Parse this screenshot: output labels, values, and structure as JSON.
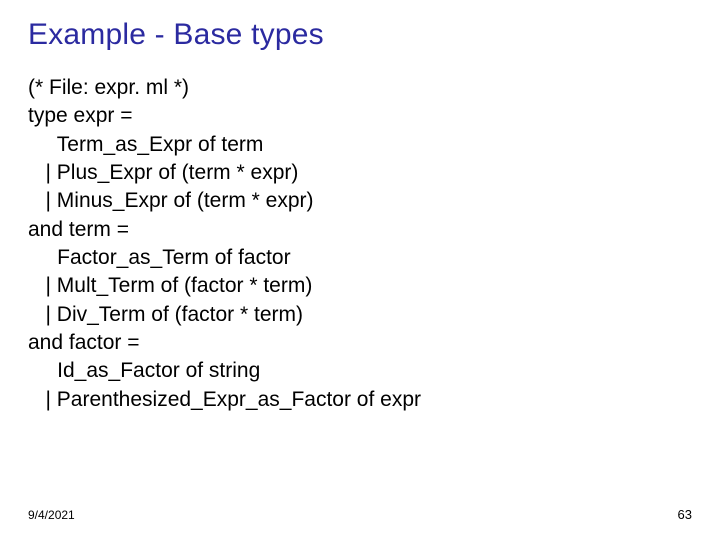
{
  "title": "Example - Base types",
  "code": {
    "l1": "(* File: expr. ml *)",
    "l2": "type expr =",
    "l3": "     Term_as_Expr of term",
    "l4": "   | Plus_Expr of (term * expr)",
    "l5": "   | Minus_Expr of (term * expr)",
    "l6": "and term =",
    "l7": "     Factor_as_Term of factor",
    "l8": "   | Mult_Term of (factor * term)",
    "l9": "   | Div_Term of (factor * term)",
    "l10": "and factor =",
    "l11": "     Id_as_Factor of string",
    "l12": "   | Parenthesized_Expr_as_Factor of expr"
  },
  "footer": {
    "date": "9/4/2021",
    "page": "63"
  }
}
